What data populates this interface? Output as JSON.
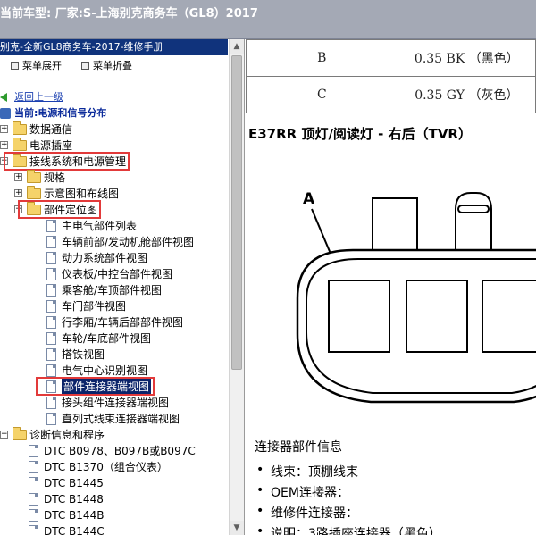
{
  "window": {
    "title": "当前车型:  厂家:S-上海别克商务车（GL8）2017"
  },
  "left_pane": {
    "header": "别克-全新GL8商务车-2017-维修手册",
    "toolbar": {
      "expand_label": "菜单展开",
      "collapse_label": "菜单折叠"
    },
    "back_link": "返回上一级",
    "current": "当前:电源和信号分布",
    "tree": [
      {
        "label": "数据通信",
        "type": "folder",
        "expander": "+"
      },
      {
        "label": "电源插座",
        "type": "folder",
        "expander": "+"
      },
      {
        "label": "接线系统和电源管理",
        "type": "folder",
        "expander": "−",
        "highlighted": true
      },
      {
        "label": "规格",
        "type": "folder",
        "expander": "+"
      },
      {
        "label": "示意图和布线图",
        "type": "folder",
        "expander": "+"
      },
      {
        "label": "部件定位图",
        "type": "folder",
        "expander": "−",
        "highlighted": true
      },
      {
        "label": "主电气部件列表",
        "type": "doc"
      },
      {
        "label": "车辆前部/发动机舱部件视图",
        "type": "doc"
      },
      {
        "label": "动力系统部件视图",
        "type": "doc"
      },
      {
        "label": "仪表板/中控台部件视图",
        "type": "doc"
      },
      {
        "label": "乘客舱/车顶部件视图",
        "type": "doc"
      },
      {
        "label": "车门部件视图",
        "type": "doc"
      },
      {
        "label": "行李厢/车辆后部部件视图",
        "type": "doc"
      },
      {
        "label": "车轮/车底部件视图",
        "type": "doc"
      },
      {
        "label": "搭铁视图",
        "type": "doc"
      },
      {
        "label": "电气中心识别视图",
        "type": "doc"
      },
      {
        "label": "部件连接器端视图",
        "type": "doc",
        "selected": true,
        "highlighted": true
      },
      {
        "label": "接头组件连接器端视图",
        "type": "doc"
      },
      {
        "label": "直列式线束连接器端视图",
        "type": "doc"
      },
      {
        "label": "诊断信息和程序",
        "type": "folder",
        "expander": "−"
      },
      {
        "label": "DTC B0978、B097B或B097C",
        "type": "doc"
      },
      {
        "label": "DTC B1370（组合仪表）",
        "type": "doc"
      },
      {
        "label": "DTC B1445",
        "type": "doc"
      },
      {
        "label": "DTC B1448",
        "type": "doc"
      },
      {
        "label": "DTC B144B",
        "type": "doc"
      },
      {
        "label": "DTC B144C",
        "type": "doc"
      }
    ]
  },
  "right_pane": {
    "pin_table": [
      {
        "pin": "B",
        "wire": "0.35 BK （黑色）"
      },
      {
        "pin": "C",
        "wire": "0.35 GY （灰色）"
      }
    ],
    "connector_title": "E37RR 顶灯/阅读灯 - 右后（TVR）",
    "diagram_label": "A",
    "info_title": "连接器部件信息",
    "info_items": [
      "线束：顶棚线束",
      "OEM连接器：",
      "维修件连接器：",
      "说明：3路插座连接器（黑色）"
    ]
  },
  "colors": {
    "titlebar": "#a4a9b5",
    "left_header": "#10337c",
    "selection": "#0b246a",
    "highlight_box": "#e23a3a",
    "folder": "#f5d36a"
  }
}
